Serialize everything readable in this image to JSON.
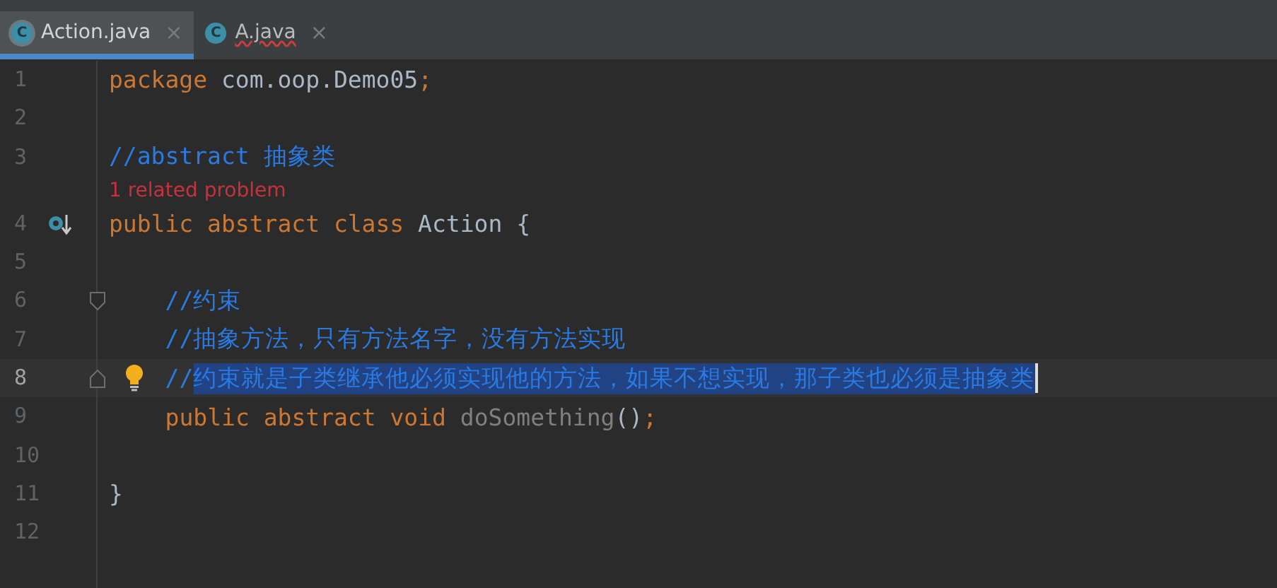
{
  "tabs": [
    {
      "label": "Action.java",
      "icon_letter": "C",
      "close": "×",
      "selected": true,
      "error": false
    },
    {
      "label": "A.java",
      "icon_letter": "C",
      "close": "×",
      "selected": false,
      "error": true
    }
  ],
  "lines": [
    {
      "kind": "code",
      "number": "1",
      "current": false,
      "implemented": false,
      "fold_start": false,
      "fold_end": false,
      "bulb": false,
      "caret": false,
      "tokens": [
        {
          "text": "package ",
          "kind": "keyword"
        },
        {
          "text": "com.oop.Demo05",
          "kind": "plain"
        },
        {
          "text": ";",
          "kind": "keyword"
        }
      ]
    },
    {
      "kind": "code",
      "number": "2",
      "current": false,
      "implemented": false,
      "fold_start": false,
      "fold_end": false,
      "bulb": false,
      "caret": false
    },
    {
      "kind": "code",
      "number": "3",
      "current": false,
      "implemented": false,
      "fold_start": false,
      "fold_end": false,
      "bulb": false,
      "caret": false,
      "tokens": [
        {
          "text": "//abstract 抽象类",
          "kind": "comment"
        }
      ]
    },
    {
      "kind": "hint",
      "text": "1 related problem"
    },
    {
      "kind": "code",
      "number": "4",
      "current": false,
      "implemented": true,
      "fold_start": false,
      "fold_end": false,
      "bulb": false,
      "caret": false,
      "tokens": [
        {
          "text": "public abstract class ",
          "kind": "keyword"
        },
        {
          "text": "Action {",
          "kind": "plain"
        }
      ],
      "children": [
        {
          "kind": "code",
          "number": "5",
          "current": false,
          "implemented": false,
          "fold_start": false,
          "fold_end": false,
          "bulb": false,
          "caret": false
        },
        {
          "kind": "code",
          "number": "6",
          "current": false,
          "implemented": false,
          "fold_start": true,
          "fold_end": false,
          "bulb": false,
          "caret": false,
          "tokens": [
            {
              "text": "//约束",
              "kind": "comment"
            }
          ]
        },
        {
          "kind": "code",
          "number": "7",
          "current": false,
          "implemented": false,
          "fold_start": false,
          "fold_end": false,
          "bulb": false,
          "caret": false,
          "tokens": [
            {
              "text": "//抽象方法，只有方法名字，没有方法实现",
              "kind": "comment"
            }
          ]
        },
        {
          "kind": "code",
          "number": "8",
          "current": true,
          "implemented": false,
          "fold_start": false,
          "fold_end": true,
          "bulb": true,
          "caret": true,
          "tokens": [
            {
              "text": "//",
              "kind": "comment"
            }
          ],
          "selection": {
            "text": "约束就是子类继承他必须实现他的方法，如果不想实现，那子类也必须是抽象类",
            "kind": "comment"
          }
        },
        {
          "kind": "code",
          "number": "9",
          "current": false,
          "implemented": false,
          "fold_start": false,
          "fold_end": false,
          "bulb": false,
          "caret": false,
          "tokens": [
            {
              "text": "public abstract void ",
              "kind": "keyword"
            },
            {
              "text": "doSomething",
              "kind": "unused"
            },
            {
              "text": "()",
              "kind": "plain"
            },
            {
              "text": ";",
              "kind": "keyword"
            }
          ]
        },
        {
          "kind": "code",
          "number": "10",
          "current": false,
          "implemented": false,
          "fold_start": false,
          "fold_end": false,
          "bulb": false,
          "caret": false
        }
      ]
    },
    {
      "kind": "code",
      "number": "11",
      "current": false,
      "implemented": false,
      "fold_start": false,
      "fold_end": false,
      "bulb": false,
      "caret": false,
      "tokens": [
        {
          "text": "}",
          "kind": "plain"
        }
      ]
    },
    {
      "kind": "code",
      "number": "12",
      "current": false,
      "implemented": false,
      "fold_start": false,
      "fold_end": false,
      "bulb": false,
      "caret": false
    }
  ]
}
